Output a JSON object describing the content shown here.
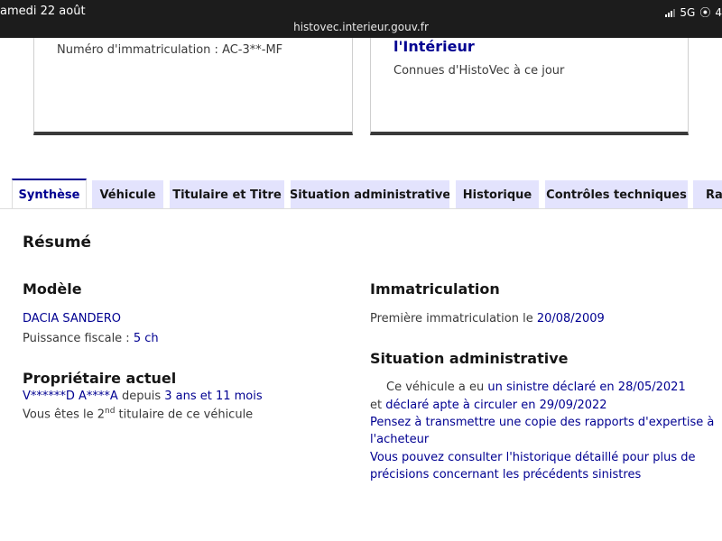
{
  "status_bar": {
    "date": "amedi 22 août",
    "network": "5G",
    "battery_partial": "4"
  },
  "browser": {
    "url": "histovec.interieur.gouv.fr"
  },
  "cards": {
    "left": {
      "text": "Numéro d'immatriculation : AC-3**-MF"
    },
    "right": {
      "title": "l'Intérieur",
      "text": "Connues d'HistoVec à ce jour"
    }
  },
  "tabs": [
    {
      "label": "Synthèse",
      "active": true
    },
    {
      "label": "Véhicule"
    },
    {
      "label": "Titulaire et Titre"
    },
    {
      "label": "Situation administrative"
    },
    {
      "label": "Historique"
    },
    {
      "label": "Contrôles techniques"
    },
    {
      "label": "Rap"
    }
  ],
  "summary": {
    "heading": "Résumé",
    "model": {
      "heading": "Modèle",
      "name": "DACIA SANDERO",
      "power_label": "Puissance fiscale : ",
      "power_value": "5 ch"
    },
    "owner": {
      "heading": "Propriétaire actuel",
      "name": "V******D A****A",
      "since_label": " depuis ",
      "since_value": "3 ans et 11 mois",
      "rank_prefix": "Vous êtes le 2",
      "rank_sup": "nd",
      "rank_suffix": " titulaire de ce véhicule"
    },
    "registration": {
      "heading": "Immatriculation",
      "first_label": "Première immatriculation le ",
      "first_date": "20/08/2009"
    },
    "admin": {
      "heading": "Situation administrative",
      "line1_prefix": "Ce véhicule a eu ",
      "line1_link": "un sinistre déclaré en 28/05/2021",
      "line2_prefix": "et ",
      "line2_link": "déclaré apte à circuler en 29/09/2022",
      "advice_line1": "Pensez à transmettre une copie des rapports d'expertise à",
      "advice_line2": "l'acheteur",
      "history_line1": "Vous pouvez consulter l'historique détaillé pour plus de",
      "history_line2": "précisions concernant les précédents sinistres"
    }
  }
}
